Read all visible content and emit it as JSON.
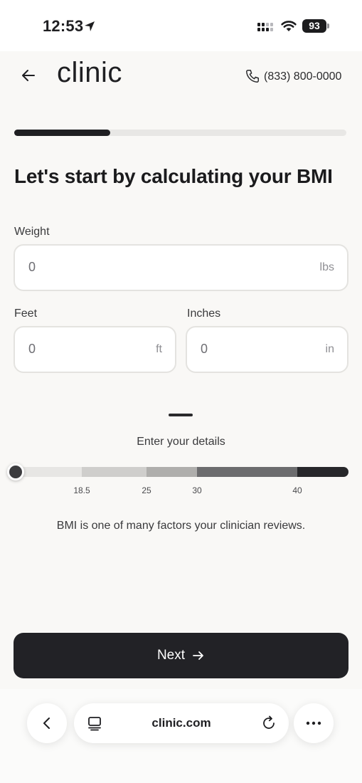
{
  "status_bar": {
    "time": "12:53",
    "battery": "93"
  },
  "header": {
    "logo": "clinic",
    "phone": "(833) 800-0000"
  },
  "progress": {
    "fraction": 0.29
  },
  "title": "Let's start by calculating your BMI",
  "form": {
    "weight": {
      "label": "Weight",
      "value": "0",
      "unit": "lbs"
    },
    "feet": {
      "label": "Feet",
      "value": "0",
      "unit": "ft"
    },
    "inches": {
      "label": "Inches",
      "value": "0",
      "unit": "in"
    }
  },
  "bmi": {
    "status": "Enter your details",
    "ticks": [
      "18.5",
      "25",
      "30",
      "40"
    ],
    "segment_colors": [
      "#e7e6e4",
      "#cfcecc",
      "#afaeac",
      "#6c6c6e",
      "#27272a"
    ],
    "disclaimer": "BMI is one of many factors your clinician reviews."
  },
  "next_button": {
    "label": "Next"
  },
  "browser": {
    "url": "clinic.com"
  },
  "colors": {
    "primary": "#222226",
    "background": "#f9f8f6"
  }
}
